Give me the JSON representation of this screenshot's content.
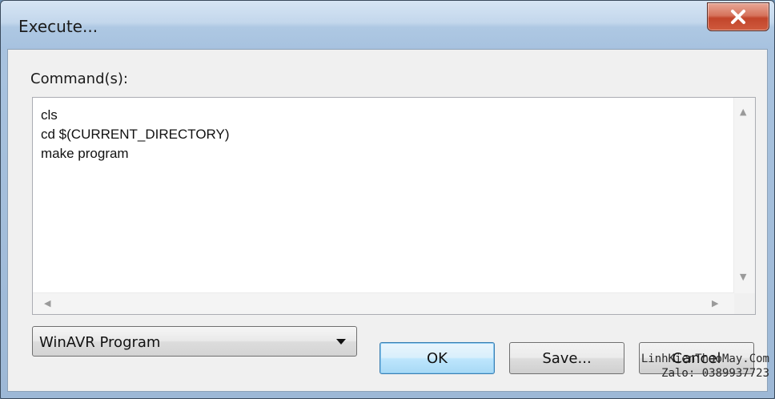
{
  "window": {
    "title": "Execute..."
  },
  "editor": {
    "label": "Command(s):",
    "text": "cls\ncd $(CURRENT_DIRECTORY)\nmake program"
  },
  "profile_select": {
    "selected": "WinAVR Program"
  },
  "buttons": {
    "ok_label": "OK",
    "save_label": "Save...",
    "cancel_label": "Cancel"
  },
  "watermark": {
    "line1": "LinhKienThaoMay.Com",
    "line2": "Zalo: 0389937723"
  },
  "icons": {
    "close": "close-icon",
    "scroll_up": "scroll-up-icon",
    "scroll_down": "scroll-down-icon",
    "scroll_left": "scroll-left-icon",
    "scroll_right": "scroll-right-icon",
    "dropdown": "chevron-down-icon"
  },
  "colors": {
    "close_button": "#c2452b",
    "default_button_border": "#3c7fb1",
    "title_bar": "#c3d7ec"
  }
}
